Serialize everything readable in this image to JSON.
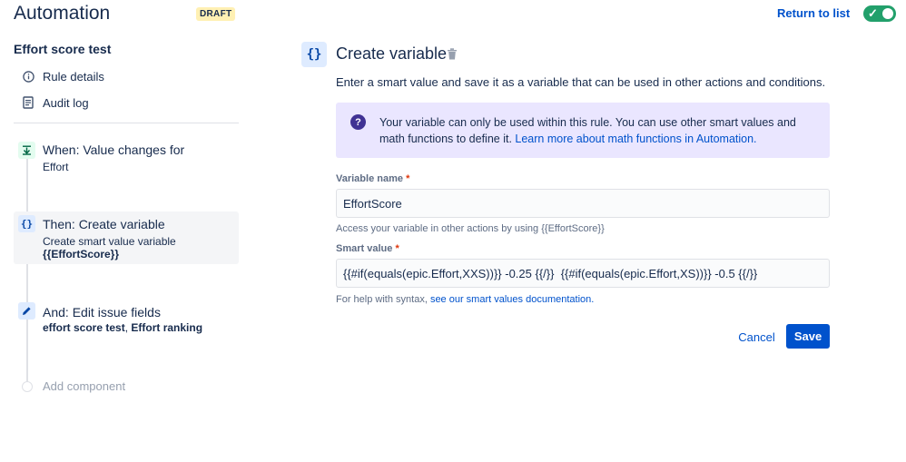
{
  "header": {
    "title": "Automation",
    "status_badge": "DRAFT",
    "return_link": "Return to list",
    "toggle_state": "on",
    "toggle_color": "#22a06b"
  },
  "sidebar": {
    "rule_name": "Effort score test",
    "links": [
      {
        "label": "Rule details",
        "icon": "info-icon"
      },
      {
        "label": "Audit log",
        "icon": "document-icon"
      }
    ],
    "steps": [
      {
        "title": "When: Value changes for",
        "sub": "Effort",
        "icon": "trigger-icon"
      },
      {
        "title": "Then: Create variable",
        "sub": "Create smart value variable",
        "sub_bold": "{{EffortScore}}",
        "icon": "braces-icon"
      },
      {
        "title": "And: Edit issue fields",
        "sub_bold_1": "effort score test",
        "sub_sep": ", ",
        "sub_bold_2": "Effort ranking",
        "icon": "pencil-icon"
      }
    ],
    "add_component": "Add component"
  },
  "panel": {
    "icon_text": "{}",
    "title": "Create variable",
    "description": "Enter a smart value and save it as a variable that can be used in other actions and conditions.",
    "info_text": "Your variable can only be used within this rule. You can use other smart values and math functions to define it. ",
    "info_link": "Learn more about math functions in Automation.",
    "variable_name_label": "Variable name",
    "variable_name_value": "EffortScore",
    "variable_name_help": "Access your variable in other actions by using {{EffortScore}}",
    "smart_value_label": "Smart value",
    "smart_value_value": "{{#if(equals(epic.Effort,XXS))}} -0.25 {{/}}  {{#if(equals(epic.Effort,XS))}} -0.5 {{/}}",
    "smart_value_help": "For help with syntax, ",
    "smart_value_help_link": "see our smart values documentation.",
    "required_mark": "*",
    "cancel_label": "Cancel",
    "save_label": "Save"
  },
  "colors": {
    "accent": "#0052cc",
    "info_bg": "#eae6ff",
    "draft_bg": "#fff0b3"
  }
}
